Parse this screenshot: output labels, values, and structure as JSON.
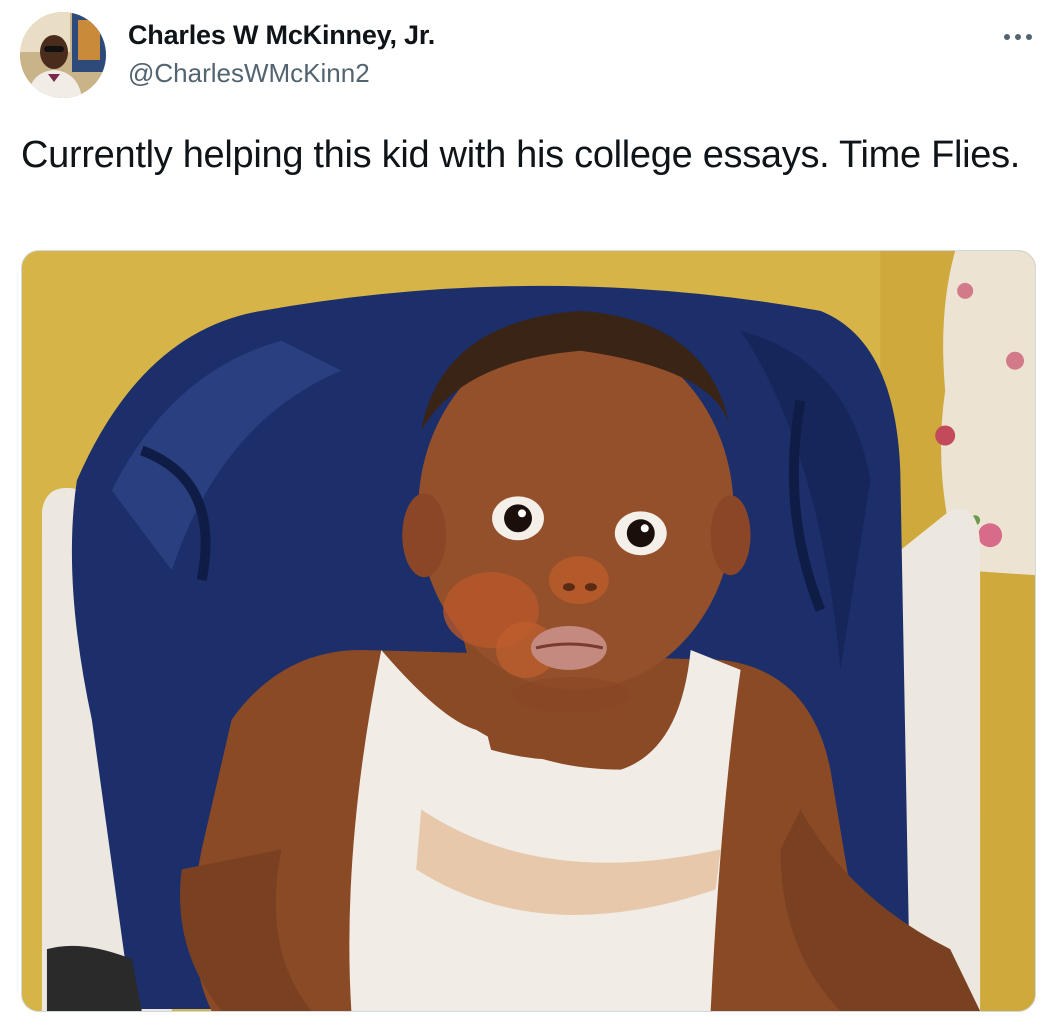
{
  "tweet": {
    "author_name": "Charles W McKinney, Jr.",
    "author_handle": "@CharlesWMcKinn2",
    "text": "Currently helping this kid with his college essays. Time Flies.",
    "more_icon": "more-horizontal-icon",
    "media": {
      "type": "photo"
    }
  },
  "colors": {
    "text_primary": "#0f1419",
    "text_secondary": "#536471",
    "border": "#cfd9de"
  }
}
